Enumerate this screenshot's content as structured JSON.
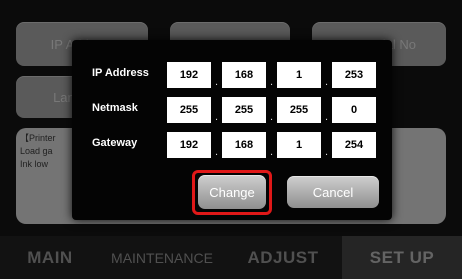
{
  "background": {
    "buttons": [
      "IP Address",
      "",
      "Serial No",
      "Language"
    ],
    "info_lines": [
      "【Printer",
      "Load ga",
      "Ink low"
    ]
  },
  "nav": {
    "items": [
      "MAIN",
      "MAINTENANCE",
      "ADJUST",
      "SET UP"
    ],
    "active": "SET UP"
  },
  "dialog": {
    "rows": [
      {
        "label": "IP Address",
        "values": [
          "192",
          "168",
          "1",
          "253"
        ]
      },
      {
        "label": "Netmask",
        "values": [
          "255",
          "255",
          "255",
          "0"
        ]
      },
      {
        "label": "Gateway",
        "values": [
          "192",
          "168",
          "1",
          "254"
        ]
      }
    ],
    "change_label": "Change",
    "cancel_label": "Cancel"
  },
  "colors": {
    "highlight": "#e01818",
    "field_bg": "#ffffff",
    "dialog_bg": "#040404"
  }
}
